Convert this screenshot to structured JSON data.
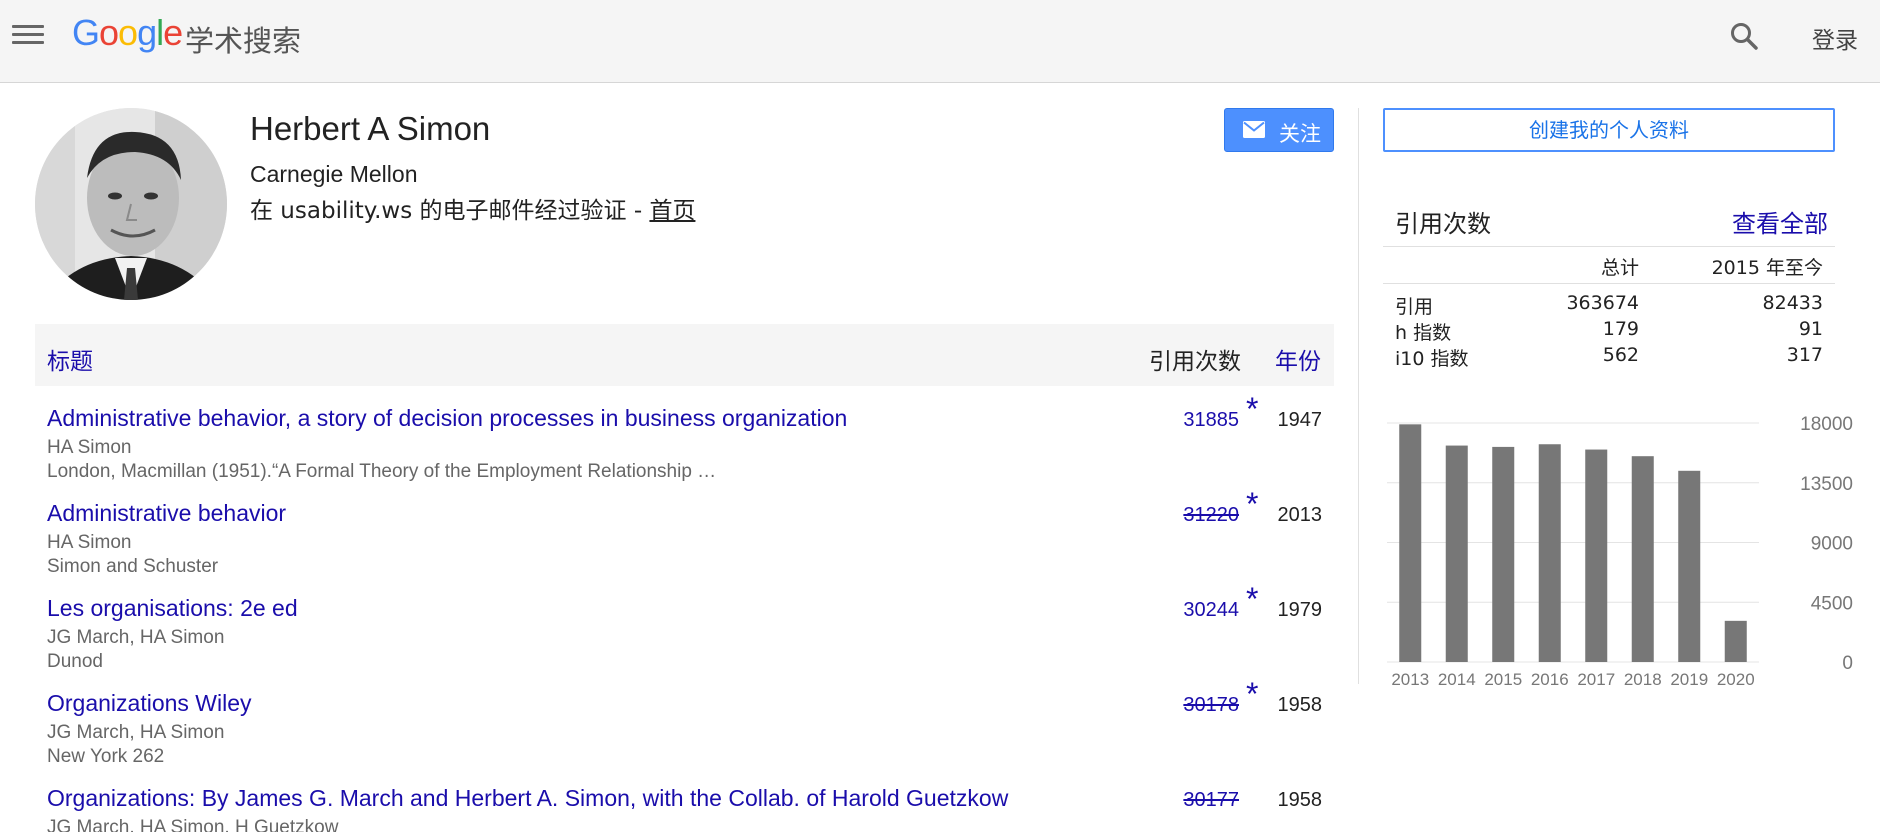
{
  "header": {
    "logo_word": "Google",
    "logo_suffix": "学术搜索",
    "signin_label": "登录"
  },
  "profile": {
    "name": "Herbert A Simon",
    "affiliation": "Carnegie Mellon",
    "email_verified": "在 usability.ws 的电子邮件经过验证 - ",
    "homepage_link": "首页",
    "follow_label": "关注"
  },
  "table": {
    "col_title": "标题",
    "col_cited": "引用次数",
    "col_year": "年份",
    "rows": [
      {
        "title": "Administrative behavior, a story of decision processes in business organization",
        "authors": "HA Simon",
        "venue": "London, Macmillan (1951).“A Formal Theory of the Employment Relationship …",
        "cites": "31885",
        "star": "*",
        "year": "1947",
        "struck": false
      },
      {
        "title": "Administrative behavior",
        "authors": "HA Simon",
        "venue": "Simon and Schuster",
        "cites": "31220",
        "star": "*",
        "year": "2013",
        "struck": true
      },
      {
        "title": "Les organisations: 2e ed",
        "authors": "JG March, HA Simon",
        "venue": "Dunod",
        "cites": "30244",
        "star": "*",
        "year": "1979",
        "struck": false
      },
      {
        "title": "Organizations Wiley",
        "authors": "JG March, HA Simon",
        "venue": "New York 262",
        "cites": "30178",
        "star": "*",
        "year": "1958",
        "struck": true
      },
      {
        "title": "Organizations: By James G. March and Herbert A. Simon, with the Collab. of Harold Guetzkow",
        "authors": "JG March, HA Simon, H Guetzkow",
        "venue": "",
        "cites": "30177",
        "star": "",
        "year": "1958",
        "struck": true
      }
    ]
  },
  "sidebar": {
    "create_profile_label": "创建我的个人资料",
    "cited_by_title": "引用次数",
    "view_all_label": "查看全部",
    "col_total": "总计",
    "col_since": "2015 年至今",
    "stats": [
      {
        "label": "引用",
        "total": "363674",
        "since": "82433"
      },
      {
        "label": "h 指数",
        "total": "179",
        "since": "91"
      },
      {
        "label": "i10 指数",
        "total": "562",
        "since": "317"
      }
    ]
  },
  "chart_data": {
    "type": "bar",
    "title": "",
    "xlabel": "",
    "ylabel": "",
    "categories": [
      "2013",
      "2014",
      "2015",
      "2016",
      "2017",
      "2018",
      "2019",
      "2020"
    ],
    "values": [
      17900,
      16300,
      16200,
      16400,
      16000,
      15500,
      14400,
      3100
    ],
    "ylim": [
      0,
      18000
    ],
    "yticks": [
      "18000",
      "13500",
      "9000",
      "4500",
      "0"
    ],
    "ytick_values": [
      18000,
      13500,
      9000,
      4500,
      0
    ],
    "bar_color": "#777777",
    "grid": true
  }
}
